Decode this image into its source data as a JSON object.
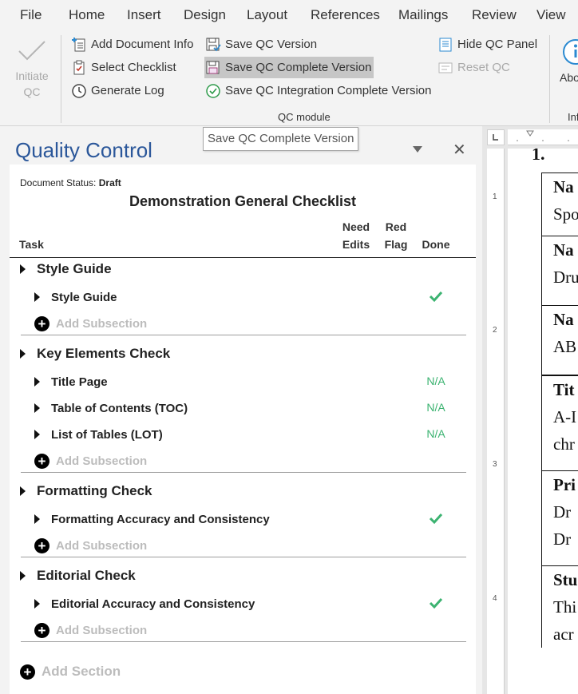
{
  "menu_tabs": [
    "File",
    "Home",
    "Insert",
    "Design",
    "Layout",
    "References",
    "Mailings",
    "Review",
    "View"
  ],
  "ribbon": {
    "initiate_qc_line1": "Initiate",
    "initiate_qc_line2": "QC",
    "add_document_info": "Add Document Info",
    "select_checklist": "Select Checklist",
    "generate_log": "Generate Log",
    "save_qc_version": "Save QC Version",
    "save_qc_complete_version": "Save QC Complete Version",
    "save_qc_integration_complete_version": "Save QC Integration Complete Version",
    "hide_qc_panel": "Hide QC Panel",
    "reset_qc": "Reset QC",
    "group_label": "QC module",
    "next_group_button": "Abo",
    "next_group_label": "Inf"
  },
  "tooltip": "Save QC Complete Version",
  "pane": {
    "title": "Quality Control",
    "document_status_label": "Document Status:",
    "document_status_value": "Draft",
    "checklist_title": "Demonstration General Checklist",
    "columns": {
      "task": "Task",
      "need_edits_1": "Need",
      "need_edits_2": "Edits",
      "red_flag_1": "Red",
      "red_flag_2": "Flag",
      "done": "Done"
    },
    "add_subsection": "Add Subsection",
    "add_section": "Add Section",
    "sections": [
      {
        "label": "Style Guide",
        "subsections": [
          {
            "label": "Style Guide",
            "done": "check"
          }
        ]
      },
      {
        "label": "Key Elements Check",
        "subsections": [
          {
            "label": "Title Page",
            "done": "N/A"
          },
          {
            "label": "Table of Contents (TOC)",
            "done": "N/A"
          },
          {
            "label": "List of Tables (LOT)",
            "done": "N/A"
          }
        ]
      },
      {
        "label": "Formatting Check",
        "subsections": [
          {
            "label": "Formatting Accuracy and Consistency",
            "done": "check"
          }
        ]
      },
      {
        "label": "Editorial Check",
        "subsections": [
          {
            "label": "Editorial Accuracy and Consistency",
            "done": "check"
          }
        ]
      }
    ]
  },
  "ruler_numbers": [
    "1",
    "2",
    "3",
    "4"
  ],
  "document": {
    "heading_number": "1.",
    "cells": [
      [
        "Na",
        "Spo"
      ],
      [
        "Na",
        "Dru"
      ],
      [
        "Na",
        "AB"
      ],
      [
        "Tit",
        "A-I",
        "chr"
      ],
      [
        "Pri",
        "Dr",
        "Dr"
      ],
      [
        "Stu",
        "Thi",
        "acr"
      ]
    ]
  },
  "colors": {
    "accent": "#2b579a",
    "done_green": "#3cb371",
    "highlight": "#c6c6c6"
  },
  "icons": [
    "checkmark-icon",
    "add-document-info-icon",
    "select-checklist-icon",
    "clock-icon",
    "save-icon",
    "save-complete-icon",
    "check-circle-icon",
    "hide-panel-icon",
    "reset-icon",
    "chevron-down-icon",
    "close-icon",
    "caret-right-icon",
    "plus-circle-icon"
  ]
}
